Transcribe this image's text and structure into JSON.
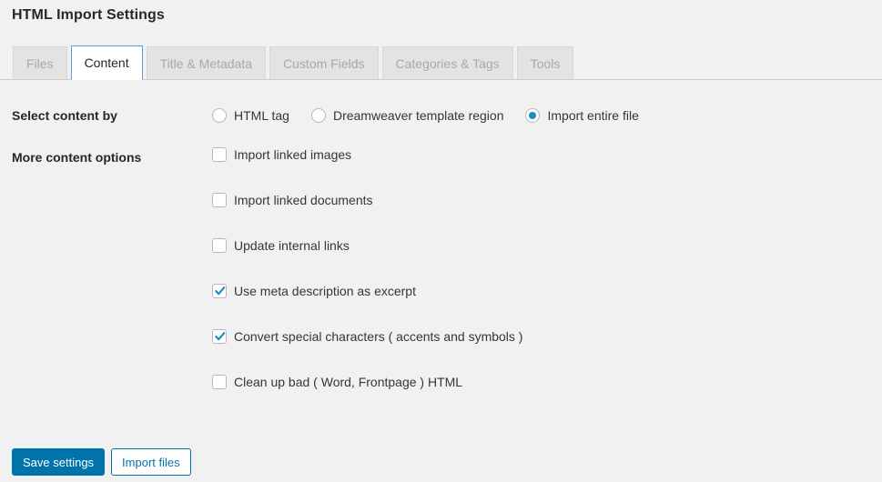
{
  "header": {
    "title": "HTML Import Settings"
  },
  "tabs": [
    {
      "label": "Files",
      "active": false
    },
    {
      "label": "Content",
      "active": true
    },
    {
      "label": "Title & Metadata",
      "active": false
    },
    {
      "label": "Custom Fields",
      "active": false
    },
    {
      "label": "Categories & Tags",
      "active": false
    },
    {
      "label": "Tools",
      "active": false
    }
  ],
  "select_content_by": {
    "label": "Select content by",
    "options": [
      {
        "label": "HTML tag",
        "selected": false
      },
      {
        "label": "Dreamweaver template region",
        "selected": false
      },
      {
        "label": "Import entire file",
        "selected": true
      }
    ]
  },
  "more_content_options": {
    "label": "More content options",
    "options": [
      {
        "label": "Import linked images",
        "checked": false
      },
      {
        "label": "Import linked documents",
        "checked": false
      },
      {
        "label": "Update internal links",
        "checked": false
      },
      {
        "label": "Use meta description as excerpt",
        "checked": true
      },
      {
        "label": "Convert special characters ( accents and symbols )",
        "checked": true
      },
      {
        "label": "Clean up bad ( Word, Frontpage ) HTML",
        "checked": false
      }
    ]
  },
  "buttons": {
    "save": "Save settings",
    "import": "Import files"
  },
  "colors": {
    "accent": "#0073aa",
    "radio_fill": "#1e8cbe",
    "active_tab_border": "#5b9dd9",
    "page_background": "#f1f1f1",
    "label_text": "#23282d",
    "option_text": "#32373c",
    "inactive_tab_text": "#a4a9ad"
  }
}
